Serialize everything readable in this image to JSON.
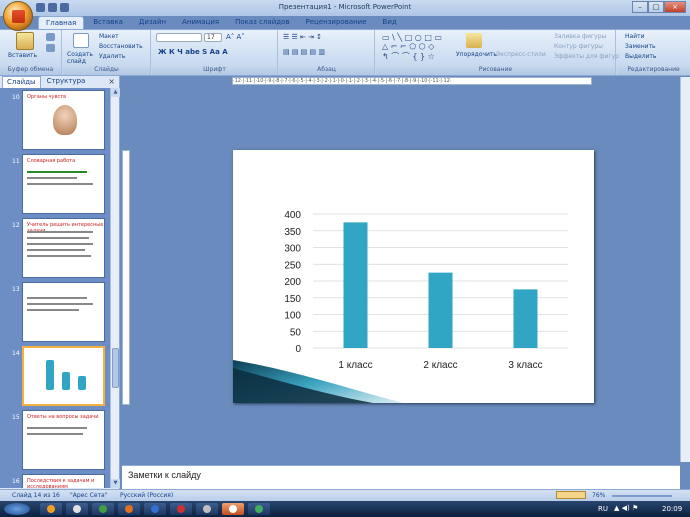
{
  "window": {
    "title": "Презентация1 - Microsoft PowerPoint"
  },
  "ribbon_tabs": [
    "Главная",
    "Вставка",
    "Дизайн",
    "Анимация",
    "Показ слайдов",
    "Рецензирование",
    "Вид"
  ],
  "ribbon": {
    "clipboard": {
      "paste": "Вставить",
      "label": "Буфер обмена"
    },
    "slides": {
      "layout": "Макет",
      "reset": "Восстановить",
      "new_slide": "Создать слайд",
      "delete": "Удалить",
      "label": "Слайды"
    },
    "font": {
      "size": "17",
      "label": "Шрифт"
    },
    "paragraph": {
      "label": "Абзац"
    },
    "drawing": {
      "arrange": "Упорядочить",
      "quick_styles": "Экспресс-стили",
      "fill": "Заливка фигуры",
      "outline": "Контур фигуры",
      "effects": "Эффекты для фигур",
      "label": "Рисование"
    },
    "editing": {
      "find": "Найти",
      "replace": "Заменить",
      "select": "Выделить",
      "label": "Редактирование"
    }
  },
  "sidebar": {
    "tabs": [
      "Слайды",
      "Структура"
    ],
    "close": "×",
    "thumbs": [
      {
        "num": "10",
        "title": "Органы чувств"
      },
      {
        "num": "11",
        "title": "Словарная работа"
      },
      {
        "num": "12",
        "title": "Учитель решить интересные задачи"
      },
      {
        "num": "13",
        "title": ""
      },
      {
        "num": "14",
        "title": ""
      },
      {
        "num": "15",
        "title": "Ответы на вопросы задачи"
      },
      {
        "num": "16",
        "title": "Последствия к задачам и исследованиям"
      }
    ]
  },
  "ruler_text": "·12·|·11·|·10·|·9·|·8·|·7·|·6·|·5·|·4·|·3·|·2·|·1·|·0·|·1·|·2·|·3·|·4·|·5·|·6·|·7·|·8·|·9·|·10·|·11·|·12·",
  "chart_data": {
    "type": "bar",
    "categories": [
      "1 класс",
      "2 класс",
      "3 класс"
    ],
    "values": [
      375,
      225,
      175
    ],
    "ylim": [
      0,
      400
    ],
    "yticks": [
      0,
      50,
      100,
      150,
      200,
      250,
      300,
      350,
      400
    ],
    "grid": true,
    "bar_color": "#31a6c4"
  },
  "notes": {
    "placeholder": "Заметки к слайду"
  },
  "statusbar": {
    "slide": "Слайд 14 из 16",
    "theme": "\"Арес Сета\"",
    "language": "Русский (Россия)",
    "zoom": "76%"
  },
  "taskbar": {
    "lang": "RU",
    "time": "20:09"
  }
}
